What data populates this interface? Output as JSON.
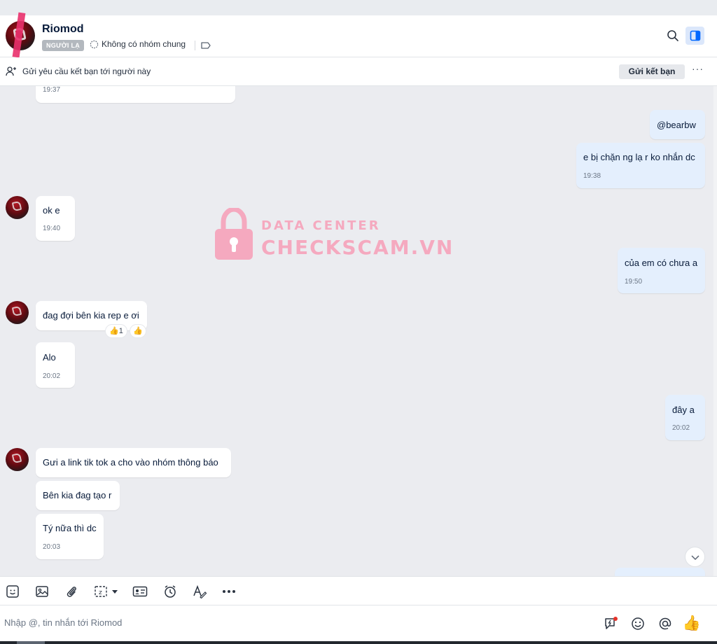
{
  "header": {
    "name": "Riomod",
    "badge": "NGƯỜI LẠ",
    "mutual_groups": "Không có nhóm chung"
  },
  "friend_bar": {
    "text": "Gửi yêu cầu kết bạn tới người này",
    "button": "Gửi kết bạn",
    "more": "···"
  },
  "watermark": {
    "line1": "DATA CENTER",
    "line2": "CHECKSCAM.VN"
  },
  "messages": {
    "m0": {
      "time": "19:37"
    },
    "m1": {
      "text": "@bearbw"
    },
    "m2": {
      "text": "e bị chặn ng lạ r ko nhắn dc",
      "time": "19:38"
    },
    "m3": {
      "text": "ok e",
      "time": "19:40"
    },
    "m4": {
      "text": "của em có chưa a",
      "time": "19:50"
    },
    "m5": {
      "text": "đag đợi bên kia rep e ơi",
      "reaction_count": "1"
    },
    "m6": {
      "text": "Alo",
      "time": "20:02"
    },
    "m7": {
      "text": "đây a",
      "time": "20:02"
    },
    "m8": {
      "text": "Gưi a link tik tok a cho vào nhóm thông báo"
    },
    "m9": {
      "text": "Bên kia đag tạo r"
    },
    "m10": {
      "text": "Tý nữa thì dc",
      "time": "20:03"
    }
  },
  "composer": {
    "placeholder": "Nhập @, tin nhắn tới Riomod"
  },
  "icons": [
    "search-icon",
    "side-panel-icon",
    "add-friend-icon",
    "sticker-icon",
    "image-icon",
    "attachment-icon",
    "screenshot-icon",
    "contact-card-icon",
    "reminder-icon",
    "text-format-icon",
    "more-icon",
    "quick-message-icon",
    "emoji-icon",
    "mention-icon",
    "thumbs-up-icon",
    "chevron-down-icon"
  ],
  "colors": {
    "accent": "#0068ff",
    "own_bubble": "#e4effd",
    "watermark": "#f5a9bf"
  }
}
